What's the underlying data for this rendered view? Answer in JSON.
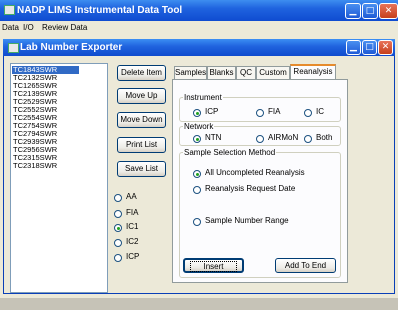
{
  "app": {
    "title": "NADP LIMS Instrumental Data Tool"
  },
  "menu": [
    "Data",
    "I/O",
    "Review Data"
  ],
  "dialog": {
    "title": "Lab Number Exporter"
  },
  "list": {
    "items": [
      "TC1843SWR",
      "TC2132SWR",
      "TC1265SWR",
      "TC2139SWR",
      "TC2529SWR",
      "TC2552SWR",
      "TC2554SWR",
      "TC2754SWR",
      "TC2794SWR",
      "TC2939SWR",
      "TC2956SWR",
      "TC2315SWR",
      "TC2318SWR"
    ],
    "selected_index": 0
  },
  "buttons": {
    "delete": "Delete Item",
    "move_up": "Move Up",
    "move_down": "Move Down",
    "print": "Print List",
    "save": "Save List",
    "insert": "Insert",
    "add_to_end": "Add To End"
  },
  "type_options": {
    "options": [
      "AA",
      "FIA",
      "IC1",
      "IC2",
      "ICP"
    ],
    "selected": "IC1"
  },
  "tabs": {
    "labels": [
      "Samples",
      "Blanks",
      "QC",
      "Custom",
      "Reanalysis"
    ],
    "active": "Reanalysis"
  },
  "instrument": {
    "label": "Instrument",
    "options": [
      "ICP",
      "FIA",
      "IC"
    ],
    "selected": "ICP"
  },
  "network": {
    "label": "Network",
    "options": [
      "NTN",
      "AIRMoN",
      "Both"
    ],
    "selected": "NTN"
  },
  "selection": {
    "label": "Sample Selection Method",
    "options": [
      "All Uncompleted Reanalysis",
      "Reanalysis Request Date",
      "Sample Number Range"
    ],
    "selected": "All Uncompleted Reanalysis"
  },
  "colors": {
    "titlebar": "#1f62de",
    "selection": "#316ac5",
    "face": "#ece9d8",
    "tab_accent": "#e68b2c"
  },
  "icons": [
    "app-icon",
    "minimize-icon",
    "maximize-icon",
    "close-icon"
  ]
}
